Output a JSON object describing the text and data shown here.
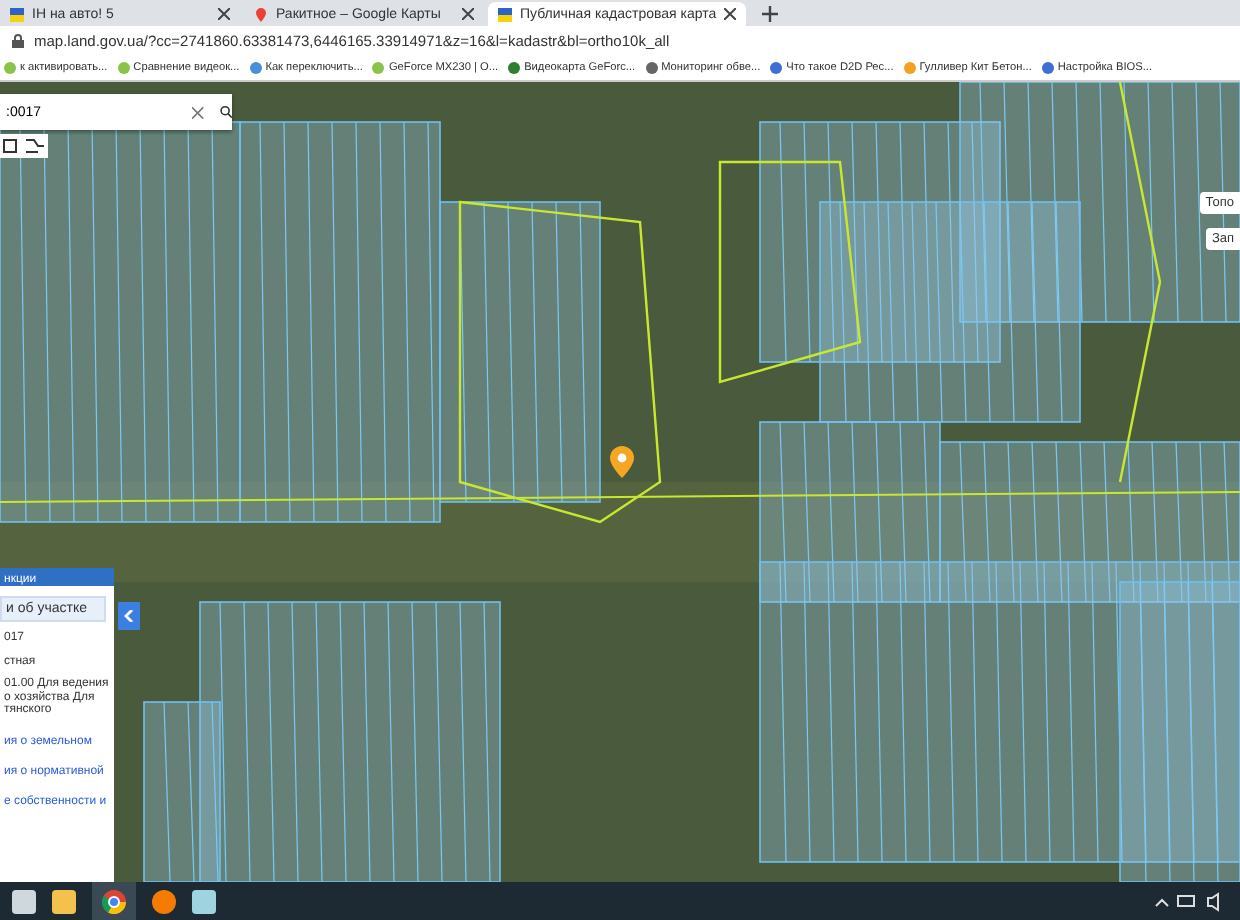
{
  "tabs": [
    {
      "title": "ІН на авто! 5",
      "selected": false
    },
    {
      "title": "Ракитное – Google Карты",
      "selected": false
    },
    {
      "title": "Публичная кадастровая карта",
      "selected": true
    }
  ],
  "address_bar": {
    "url": "map.land.gov.ua/?cc=2741860.63381473,6446165.33914971&z=16&l=kadastr&bl=ortho10k_all"
  },
  "bookmarks": [
    "к активировать...",
    "Сравнение видеок...",
    "Как переключить...",
    "GeForce MX230 | O...",
    "Видеокарта GeForc...",
    "Мониторинг обве...",
    "Что такое D2D Рес...",
    "Гулливер Кит Бетон...",
    "Настройка BIOS..."
  ],
  "map": {
    "search": {
      "value": ":0017"
    },
    "layer_buttons": [
      "Топо",
      "Зап"
    ],
    "info_panel": {
      "header": "нкции",
      "section_title": "и об участке",
      "lines": [
        "017",
        "стная",
        "01.00 Для ведения о хозяйства Для тянского"
      ],
      "links": [
        "ия о земельном",
        "ия о нормативной",
        "е собственности и"
      ]
    }
  }
}
